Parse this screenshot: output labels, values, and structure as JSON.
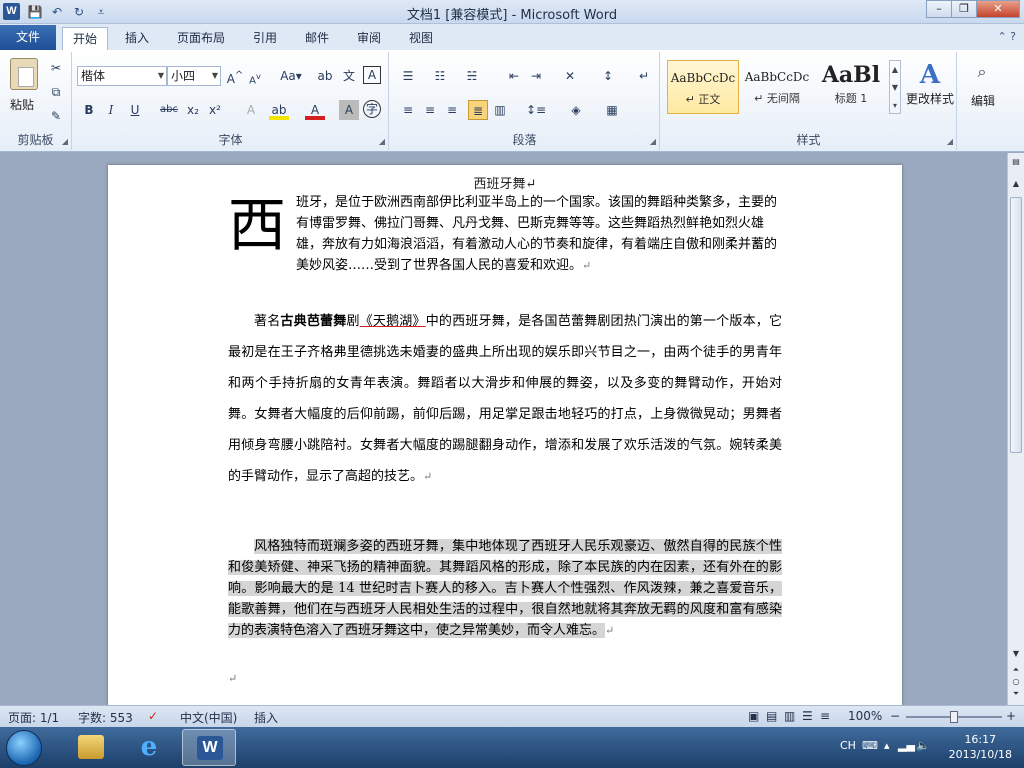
{
  "window": {
    "title": "文档1 [兼容模式] - Microsoft Word",
    "minimize": "–",
    "maximize": "❐",
    "close": "✕"
  },
  "qat": {
    "save": "💾",
    "undo": "↶",
    "redo": "↻",
    "customize": "⩡"
  },
  "tabs": [
    {
      "label": "文件"
    },
    {
      "label": "开始"
    },
    {
      "label": "插入"
    },
    {
      "label": "页面布局"
    },
    {
      "label": "引用"
    },
    {
      "label": "邮件"
    },
    {
      "label": "审阅"
    },
    {
      "label": "视图"
    }
  ],
  "ribbon": {
    "clipboard": {
      "label": "剪贴板",
      "paste": "粘贴"
    },
    "font": {
      "label": "字体",
      "font_name": "楷体",
      "font_size": "小四"
    },
    "paragraph": {
      "label": "段落"
    },
    "styles": {
      "label": "样式",
      "items": [
        {
          "sample": "AaBbCcDc",
          "name": "↵ 正文"
        },
        {
          "sample": "AaBbCcDc",
          "name": "↵ 无间隔"
        },
        {
          "sample": "AaBl",
          "name": "标题 1"
        }
      ],
      "change_styles": "更改样式"
    },
    "editing": {
      "label": "编辑"
    }
  },
  "document": {
    "title": "西班牙舞↵",
    "dropcap": "西",
    "p1": "班牙，是位于欧洲西南部伊比利亚半岛上的一个国家。该国的舞蹈种类繁多，主要的有博雷罗舞、佛拉门哥舞、凡丹戈舞、巴斯克舞等等。这些舞蹈热烈鲜艳如烈火雄雄，奔放有力如海浪滔滔，有着激动人心的节奏和旋律，有着端庄自傲和刚柔并蓄的美妙风姿……受到了世界各国人民的喜爱和欢迎。",
    "p2_prefix": "著名",
    "p2_bold": "古典芭蕾舞",
    "p2_mid": "剧",
    "p2_link": "《天鹅湖》",
    "p2_rest": "中的西班牙舞，是各国芭蕾舞剧团热门演出的第一个版本，它最初是在王子齐格弗里德挑选未婚妻的盛典上所出现的娱乐即兴节目之一，由两个徒手的男青年和两个手持折扇的女青年表演。舞蹈者以大滑步和伸展的舞姿，以及多变的舞臂动作，开始对舞。女舞者大幅度的后仰前踢，前仰后踢，用足掌足跟击地轻巧的打点，上身微微晃动；男舞者用倾身弯腰小跳陪衬。女舞者大幅度的踢腿翻身动作，增添和发展了欢乐活泼的气氛。婉转柔美的手臂动作，显示了高超的技艺。",
    "p3": "风格独特而斑斓多姿的西班牙舞，集中地体现了西班牙人民乐观豪迈、傲然自得的民族个性和俊美矫健、神采飞扬的精神面貌。其舞蹈风格的形成，除了本民族的内在因素，还有外在的影响。影响最大的是 14 世纪时吉卜赛人的移入。吉卜赛人个性强烈、作风泼辣，兼之喜爱音乐，能歌善舞，他们在与西班牙人民相处生活的过程中，很自然地就将其奔放无羁的风度和富有感染力的表演特色溶入了西班牙舞这中，使之异常美妙，而令人难忘。",
    "para_mark": "↵"
  },
  "status": {
    "page": "页面: 1/1",
    "words": "字数: 553",
    "language": "中文(中国)",
    "mode": "插入",
    "zoom": "100%",
    "zoom_minus": "−",
    "zoom_plus": "+"
  },
  "taskbar": {
    "ime": "CH",
    "time": "16:17",
    "date": "2013/10/18"
  },
  "colors": {
    "ribbon_tab_file": "#2b5797",
    "taskbar": "#1d3f6a",
    "page_bg": "#ffffff",
    "doc_bg": "#9aa9bf"
  }
}
